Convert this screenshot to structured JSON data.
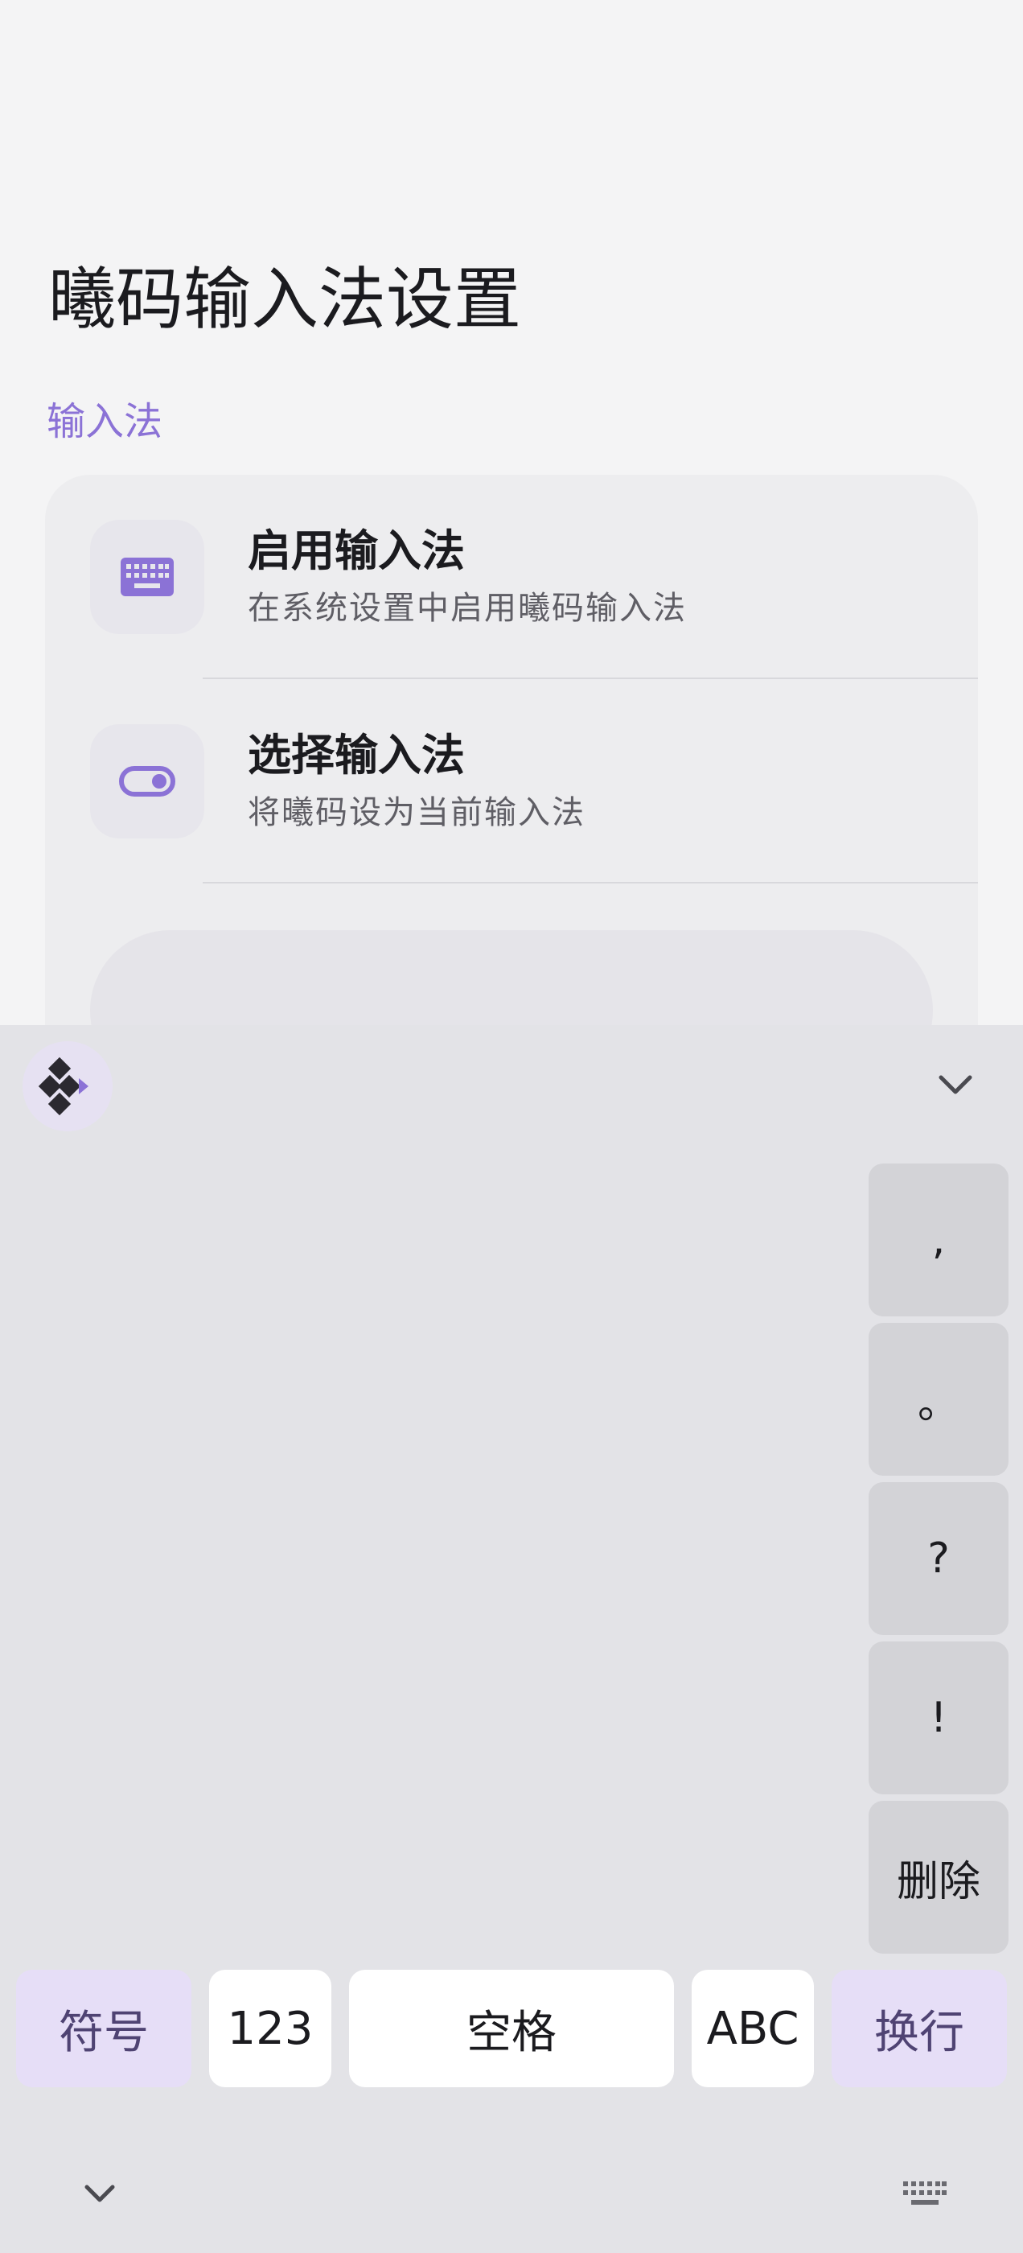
{
  "page": {
    "title": "曦码输入法设置",
    "section_label": "输入法"
  },
  "settings": {
    "items": [
      {
        "title": "启用输入法",
        "subtitle": "在系统设置中启用曦码输入法",
        "icon": "keyboard-icon"
      },
      {
        "title": "选择输入法",
        "subtitle": "将曦码设为当前输入法",
        "icon": "toggle-icon"
      }
    ]
  },
  "keyboard": {
    "logo_icon": "app-logo-icon",
    "collapse_icon": "chevron-down-icon",
    "side_keys": [
      ",",
      "。",
      "?",
      "!",
      "删除"
    ],
    "bottom_keys": {
      "symbol": "符号",
      "numbers": "123",
      "space": "空格",
      "abc": "ABC",
      "enter": "换行"
    },
    "nav_left_icon": "chevron-down-icon",
    "nav_right_icon": "keyboard-switch-icon"
  },
  "colors": {
    "accent": "#8b72d6",
    "accent_key_bg": "#e6def7",
    "keyboard_bg": "#e3e3e7"
  }
}
